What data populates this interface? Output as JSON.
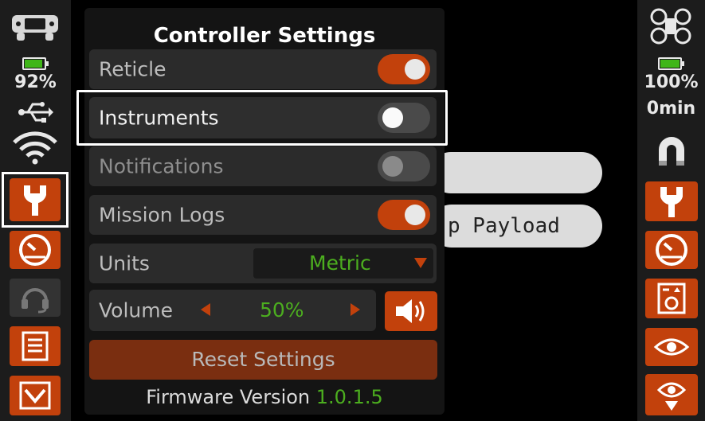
{
  "left_rail": {
    "battery_percent": "92%",
    "battery_level": 0.92,
    "icons": [
      "gamepad-icon",
      "usb-icon",
      "wifi-icon",
      "wrench-icon",
      "gauge-icon",
      "headset-icon",
      "document-icon",
      "chevron-down-icon"
    ]
  },
  "right_rail": {
    "battery_percent": "100%",
    "battery_level": 1.0,
    "flight_time": "0min",
    "icons": [
      "drone-icon",
      "magnet-icon",
      "wrench-icon",
      "gauge-icon",
      "drone-list-icon",
      "eye-icon",
      "location-eye-icon"
    ]
  },
  "background": {
    "payload_button_text": "p Payload"
  },
  "panel": {
    "title": "Controller Settings",
    "rows": [
      {
        "label": "Reticle",
        "state": "on"
      },
      {
        "label": "Instruments",
        "state": "off"
      },
      {
        "label": "Notifications",
        "state": "off"
      },
      {
        "label": "Mission Logs",
        "state": "on"
      }
    ],
    "units": {
      "label": "Units",
      "value": "Metric"
    },
    "volume": {
      "label": "Volume",
      "value": "50%"
    },
    "reset_label": "Reset Settings",
    "firmware_label": "Firmware Version",
    "firmware_version": "1.0.1.5"
  },
  "colors": {
    "accent": "#c2410c",
    "green": "#4cae1f",
    "panel_bg": "#141414"
  }
}
